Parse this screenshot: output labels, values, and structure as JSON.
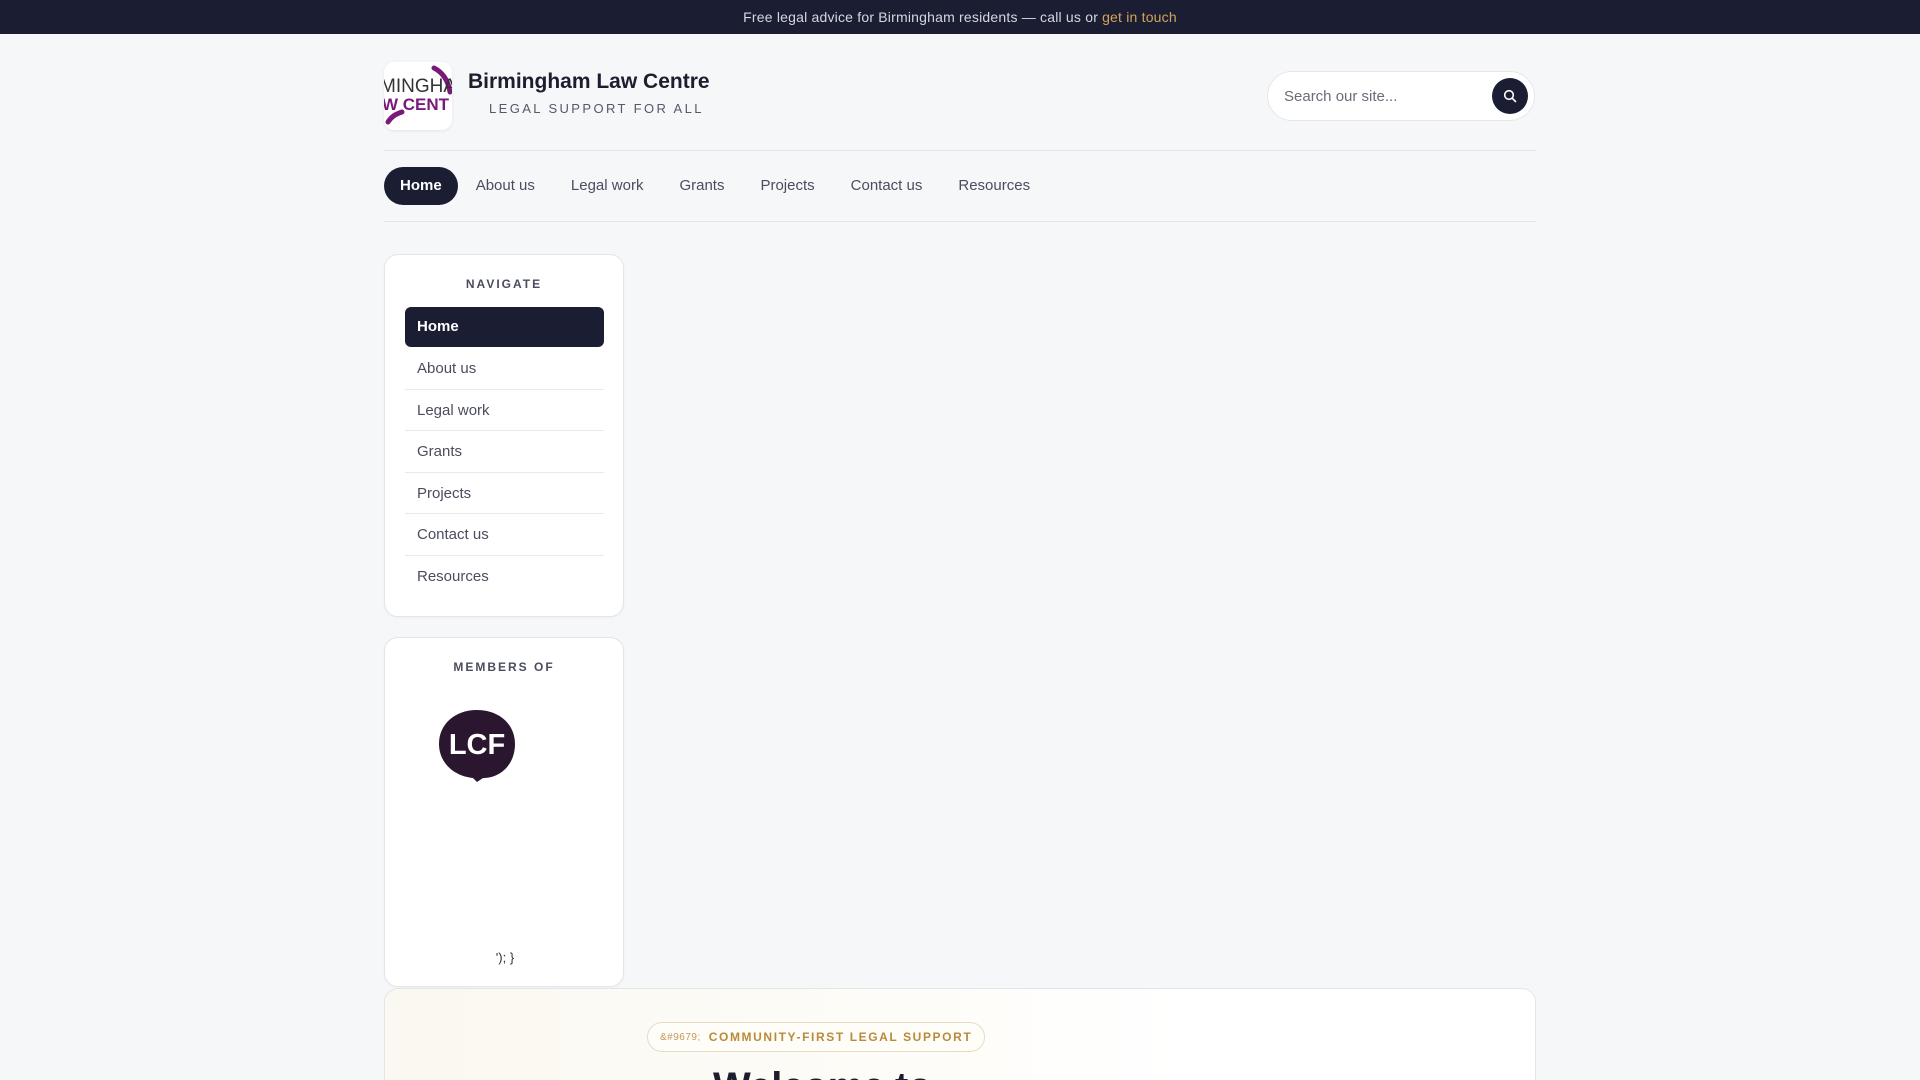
{
  "topbar": {
    "text": "Free legal advice for Birmingham residents — call us or",
    "link": "get in touch"
  },
  "brand": {
    "logo_text_top": "MINGHA",
    "logo_text_bottom": "W CENT",
    "title": "Birmingham Law Centre",
    "subtitle": "LEGAL SUPPORT FOR ALL"
  },
  "search": {
    "placeholder": "Search our site..."
  },
  "nav": {
    "items": [
      {
        "label": "Home",
        "active": true
      },
      {
        "label": "About us"
      },
      {
        "label": "Legal work"
      },
      {
        "label": "Grants"
      },
      {
        "label": "Projects"
      },
      {
        "label": "Contact us"
      },
      {
        "label": "Resources"
      }
    ]
  },
  "sidebar": {
    "heading": "NAVIGATE",
    "items": [
      {
        "label": "Home",
        "active": true
      },
      {
        "label": "About us"
      },
      {
        "label": "Legal work"
      },
      {
        "label": "Grants"
      },
      {
        "label": "Projects"
      },
      {
        "label": "Contact us"
      },
      {
        "label": "Resources"
      }
    ]
  },
  "members": {
    "heading": "MEMBERS OF",
    "badge_text": "LCF",
    "stray_text": "'); }"
  },
  "hero": {
    "pill_entity": "&#9679;",
    "pill_label": "COMMUNITY-FIRST LEGAL SUPPORT",
    "title": "Welcome to"
  },
  "colors": {
    "navy": "#1b1d33",
    "gold": "#d6a35c",
    "logo_purple": "#7a1a78"
  }
}
